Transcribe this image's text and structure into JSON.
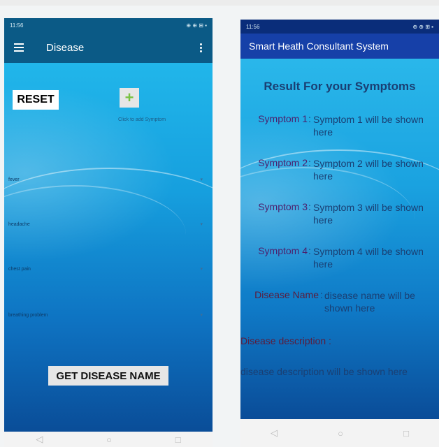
{
  "left_screen": {
    "status": {
      "time": "11:56",
      "right": "⊕ ⊕ ⊞ ▪"
    },
    "appbar": {
      "title": "Disease"
    },
    "reset_label": "RESET",
    "plus_label": "+",
    "add_caption": "Click to add Symptom",
    "symptom_spinners": [
      "fever",
      "headache",
      "chest pain",
      "breathing problem"
    ],
    "get_button_label": "GET DISEASE NAME",
    "fab_glyph": "✉",
    "nav": [
      "◁",
      "○",
      "□"
    ]
  },
  "right_screen": {
    "status": {
      "time": "11:56",
      "right": "⊕ ⊕ ⊞ ▪"
    },
    "appbar": {
      "title": "Smart Heath Consultant System"
    },
    "heading": "Result For your Symptoms",
    "symptoms": [
      {
        "label": "Symptom 1",
        "value": "Symptom 1 will be shown here"
      },
      {
        "label": "Symptom 2",
        "value": "Symptom 2 will be shown here"
      },
      {
        "label": "Symptom 3",
        "value": "Symptom 3 will be shown here"
      },
      {
        "label": "Symptom 4",
        "value": "Symptom 4 will be shown here"
      }
    ],
    "disease_name_label": "Disease Name",
    "disease_name_value": "disease name will be shown here",
    "description_label": "Disease description",
    "description_value": "disease description will be shown here",
    "nav": [
      "◁",
      "○",
      "□"
    ]
  },
  "colors": {
    "left_appbar": "#0b5a86",
    "right_appbar": "#1640a8",
    "fab": "#e2245b",
    "label_purple": "#4c1f6c",
    "value_blue": "#1a3f73"
  }
}
